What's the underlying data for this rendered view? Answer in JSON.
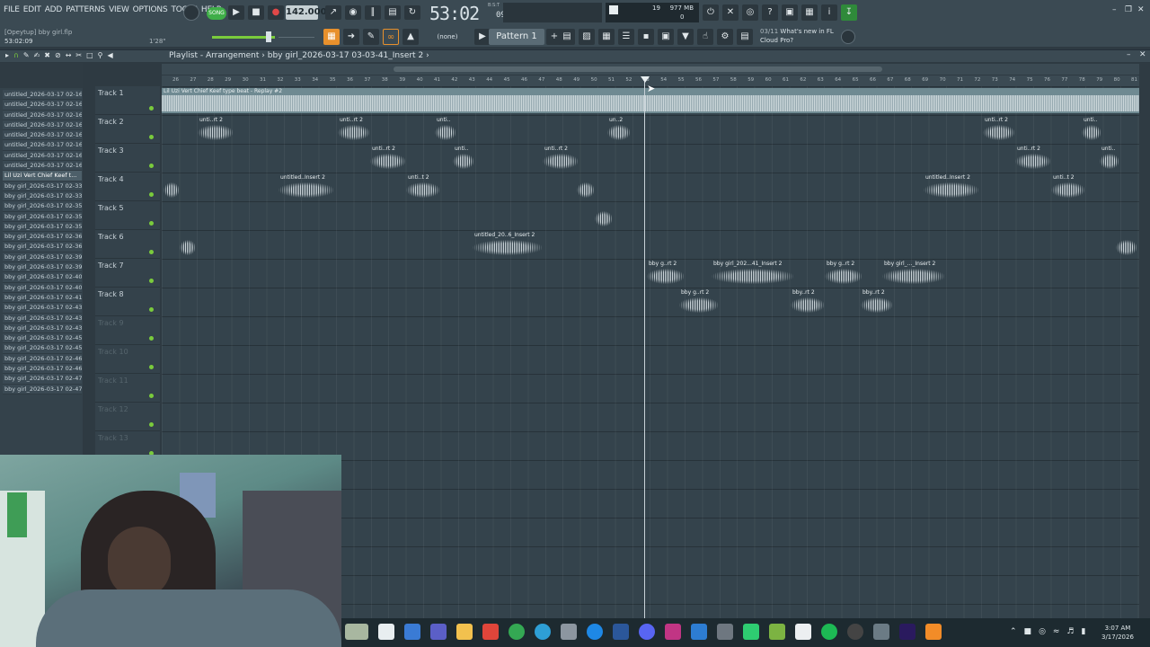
{
  "menu": [
    "FILE",
    "EDIT",
    "ADD",
    "PATTERNS",
    "VIEW",
    "OPTIONS",
    "TOOLS",
    "HELP"
  ],
  "hint": {
    "file": "[Opeytup] bby girl.flp",
    "time": "53:02:09",
    "version": "1'28\""
  },
  "transport": {
    "song_label": "SONG",
    "tempo": "142.000",
    "time_main": "53:02",
    "time_sub": "09",
    "bst": "B:S:T"
  },
  "cpu": {
    "value1": "19",
    "ram": "977 MB",
    "value3": "0"
  },
  "pattern": {
    "selector": "(none)",
    "name": "Pattern 1"
  },
  "news": {
    "date": "03/11",
    "line1": "What's new in FL",
    "line2": "Cloud Pro?"
  },
  "playlist": {
    "title": "Playlist - Arrangement",
    "crumb": "bby girl_2026-03-17 03-03-41_Insert 2",
    "separator": "›"
  },
  "browser_items": [
    "untitled_2026-03-17 02-16...",
    "untitled_2026-03-17 02-16...",
    "untitled_2026-03-17 02-16...",
    "untitled_2026-03-17 02-16...",
    "untitled_2026-03-17 02-16...",
    "untitled_2026-03-17 02-16...",
    "untitled_2026-03-17 02-16...",
    "untitled_2026-03-17 02-16...",
    "Lil Uzi Vert  Chief Keef t...",
    "bby girl_2026-03-17 02-33...",
    "bby girl_2026-03-17 02-33...",
    "bby girl_2026-03-17 02-35...",
    "bby girl_2026-03-17 02-35...",
    "bby girl_2026-03-17 02-35...",
    "bby girl_2026-03-17 02-36...",
    "bby girl_2026-03-17 02-36...",
    "bby girl_2026-03-17 02-39...",
    "bby girl_2026-03-17 02-39...",
    "bby girl_2026-03-17 02-40...",
    "bby girl_2026-03-17 02-40...",
    "bby girl_2026-03-17 02-41...",
    "bby girl_2026-03-17 02-43...",
    "bby girl_2026-03-17 02-43...",
    "bby girl_2026-03-17 02-43...",
    "bby girl_2026-03-17 02-45...",
    "bby girl_2026-03-17 02-45...",
    "bby girl_2026-03-17 02-46...",
    "bby girl_2026-03-17 02-46...",
    "bby girl_2026-03-17 02-47...",
    "bby girl_2026-03-17 02-47..."
  ],
  "tracks": [
    "Track 1",
    "Track 2",
    "Track 3",
    "Track 4",
    "Track 5",
    "Track 6",
    "Track 7",
    "Track 8",
    "Track 9",
    "Track 10",
    "Track 11",
    "Track 12",
    "Track 13"
  ],
  "ruler": [
    "26",
    "27",
    "28",
    "29",
    "30",
    "31",
    "32",
    "33",
    "34",
    "35",
    "36",
    "37",
    "38",
    "39",
    "40",
    "41",
    "42",
    "43",
    "44",
    "45",
    "46",
    "47",
    "48",
    "49",
    "50",
    "51",
    "52",
    "53",
    "54",
    "55",
    "56",
    "57",
    "58",
    "59",
    "60",
    "61",
    "62",
    "63",
    "64",
    "65",
    "66",
    "67",
    "68",
    "69",
    "70",
    "71",
    "72",
    "73",
    "74",
    "75",
    "76",
    "77",
    "78",
    "79",
    "80",
    "81"
  ],
  "clips": {
    "t1": "Lil Uzi Vert  Chief Keef type beat - Replay #2",
    "t2a": "unti..rt 2",
    "t2b": "unti..rt 2",
    "t2c": "unti..",
    "t2d": "un..2",
    "t2e": "unti..rt 2",
    "t2f": "unti..",
    "t3a": "unti..rt 2",
    "t3b": "unti..",
    "t3c": "unti..rt 2",
    "t3d": "unti..rt 2",
    "t3e": "unti..",
    "t4a": "",
    "t4b": "untitled..Insert 2",
    "t4c": "unti..t 2",
    "t4d": "",
    "t4e": "untitled..Insert 2",
    "t4f": "unti..t 2",
    "t5a": "",
    "t6a": "",
    "t6b": "untitled_20..6_Insert 2",
    "t6c": "",
    "t7a": "bby g..rt 2",
    "t7b": "bby girl_202...41_Insert 2",
    "t7c": "bby g..rt 2",
    "t7d": "bby girl_..._Insert 2",
    "t8a": "bby g..rt 2",
    "t8b": "bby..rt 2",
    "t8c": "bby..rt 2"
  },
  "clock": {
    "time": "3:07 AM",
    "date": "3/17/2026"
  },
  "colors": {
    "song_green": "#3fae48",
    "accent_orange": "#e8902c",
    "led_green": "#7acb3c"
  }
}
